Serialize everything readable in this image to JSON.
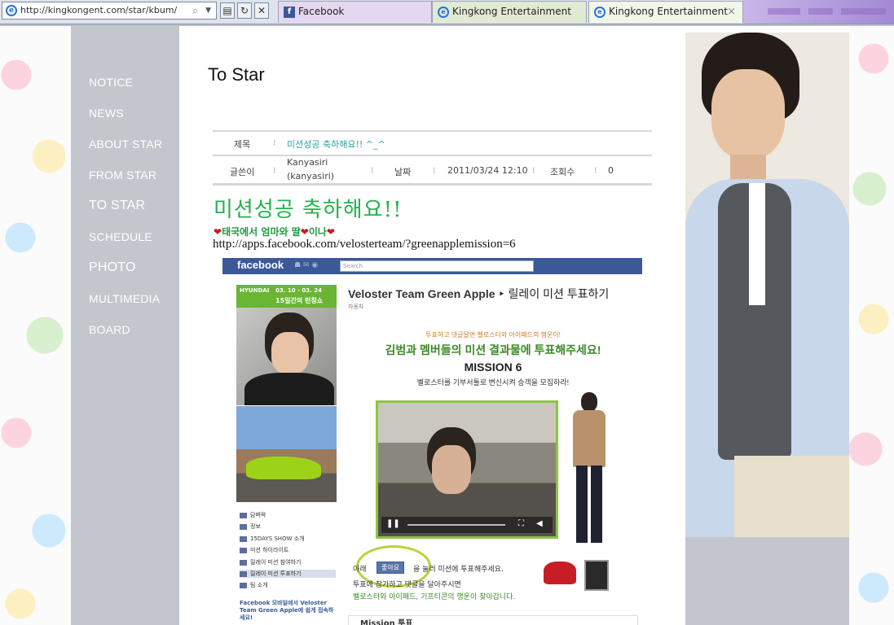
{
  "browser": {
    "address": "http://kingkongent.com/star/kbum/",
    "tabs": [
      {
        "label": "Facebook",
        "icon": "facebook-icon"
      },
      {
        "label": "Kingkong Entertainment",
        "icon": "ie-icon"
      },
      {
        "label": "Kingkong Entertainment",
        "icon": "ie-icon",
        "active": true
      }
    ],
    "close_glyph": "×"
  },
  "sidebar": {
    "items": [
      "NOTICE",
      "NEWS",
      "ABOUT STAR",
      "FROM STAR",
      "TO STAR",
      "SCHEDULE",
      "PHOTO",
      "MULTIMEDIA",
      "BOARD"
    ]
  },
  "page": {
    "title": "To Star",
    "post": {
      "subject_label": "제목",
      "subject": "미션성공 축하해요!! ^_^",
      "author_label": "글쓴이",
      "author": "Kanyasiri",
      "author_id": "(kanyasiri)",
      "date_label": "날짜",
      "date": "2011/03/24 12:10",
      "views_label": "조회수",
      "views": "0"
    },
    "body": {
      "headline": "미션성공 축하해요!!",
      "subline_parts": [
        "태국에서 엄마와 딸",
        "이나"
      ],
      "link": "http://apps.facebook.com/velosterteam/?greenapplemission=6"
    },
    "fb": {
      "logo": "facebook",
      "search_placeholder": "Search",
      "page_title": "Veloster Team Green Apple",
      "page_title_rest": "‣ 릴레이 미션 투표하기",
      "category": "자동차",
      "banner_date": "03. 10 - 03. 24",
      "banner_text": "15일간의 런칭쇼",
      "banner_brand": "HYUNDAI",
      "menu": [
        "담벼락",
        "정보",
        "15DAYS SHOW 소개",
        "미션 하이라이트",
        "릴레이 미션 참여하기",
        "릴레이 미션 투표하기",
        "팀 소개"
      ],
      "promo": "Facebook 모바일에서 Veloster Team Green Apple에 쉽게 접속하세요!",
      "mission": {
        "line1": "투표하고 댓글달면 벨로스터와 아이패드의 행운이!",
        "line2": "김범과 멤버들의 미션 결과물에 투표해주세요!",
        "line3": "MISSION 6",
        "line4": "벨로스터를 기부서틀로 변신시켜 승객을 모집하라!",
        "like_label": "좋아요",
        "vote_pre": "아래",
        "vote_post": "을 눌러 미션에 투표해주세요.",
        "line6": "투표에 참가하고 댓글을 달아주시면",
        "line7": "벨로스터와 아이패드, 기프티콘의 행운이 찾아갑니다.",
        "footer": "Mission 투표"
      }
    }
  },
  "colors": {
    "sidebar": "#c3c6cd",
    "title_green": "#22b24c",
    "fb_blue": "#3b5998",
    "subject_teal": "#2aa197"
  }
}
